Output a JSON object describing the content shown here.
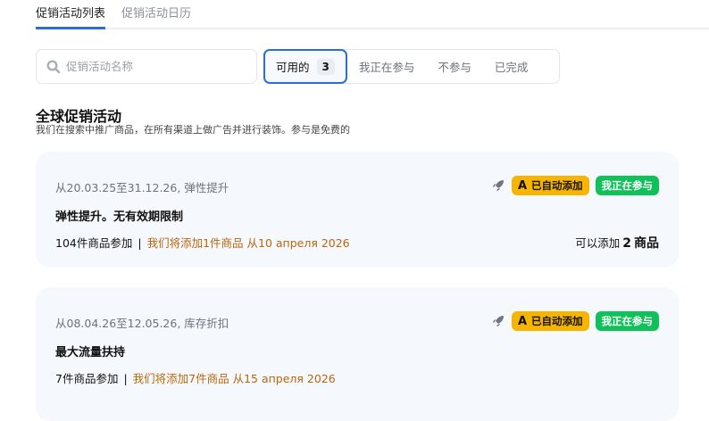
{
  "tabs": [
    {
      "label": "促销活动列表",
      "active": true
    },
    {
      "label": "促销活动日历",
      "active": false
    }
  ],
  "search": {
    "placeholder": "促销活动名称",
    "value": ""
  },
  "filters": [
    {
      "label": "可用的",
      "count": "3",
      "active": true
    },
    {
      "label": "我正在参与"
    },
    {
      "label": "不参与"
    },
    {
      "label": "已完成"
    }
  ],
  "section": {
    "title": "全球促销活动",
    "subtitle": "我们在搜索中推广商品，在所有渠道上做广告并进行装饰。参与是免费的"
  },
  "promotions": [
    {
      "meta": "从20.03.25至31.12.26, 弹性提升",
      "title": "弹性提升。无有效期限制",
      "participating": "104件商品参加",
      "note": "我们将添加1件商品 从10 апреля 2026",
      "auto_badge": "已自动添加",
      "auto_letter": "A",
      "status_badge": "我正在参与",
      "can_add_prefix": "可以添加",
      "can_add_count": "2",
      "can_add_suffix": "商品"
    },
    {
      "meta": "从08.04.26至12.05.26, 库存折扣",
      "title": "最大流量扶持",
      "participating": "7件商品参加",
      "note": "我们将添加7件商品 从15 апреля 2026",
      "auto_badge": "已自动添加",
      "auto_letter": "A",
      "status_badge": "我正在参与"
    }
  ]
}
